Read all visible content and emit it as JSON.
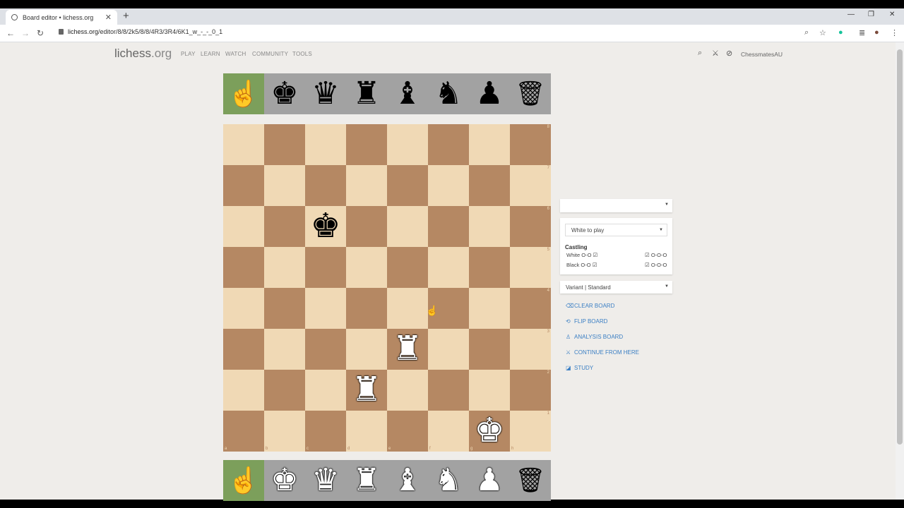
{
  "browser": {
    "tab_title": "Board editor • lichess.org",
    "tab_close": "✕",
    "new_tab": "+",
    "url_host": "lichess.org",
    "url_path": "/editor/8/8/2k5/8/8/4R3/3R4/6K1_w_-_-_0_1"
  },
  "site": {
    "logo_main": "lichess",
    "logo_tld": ".org",
    "menu": [
      "PLAY",
      "LEARN",
      "WATCH",
      "COMMUNITY",
      "TOOLS"
    ],
    "username": "ChessmatesAU"
  },
  "spare_top": [
    {
      "piece": "hand",
      "glyph": "☝",
      "selected": true
    },
    {
      "piece": "black-king",
      "glyph": "♚"
    },
    {
      "piece": "black-queen",
      "glyph": "♛"
    },
    {
      "piece": "black-rook",
      "glyph": "♜"
    },
    {
      "piece": "black-bishop",
      "glyph": "♝"
    },
    {
      "piece": "black-knight",
      "glyph": "♞"
    },
    {
      "piece": "black-pawn",
      "glyph": "♟"
    },
    {
      "piece": "trash",
      "glyph": "🗑"
    }
  ],
  "spare_bottom": [
    {
      "piece": "hand",
      "glyph": "☝",
      "selected": true
    },
    {
      "piece": "white-king",
      "glyph": "♚"
    },
    {
      "piece": "white-queen",
      "glyph": "♛"
    },
    {
      "piece": "white-rook",
      "glyph": "♜"
    },
    {
      "piece": "white-bishop",
      "glyph": "♝"
    },
    {
      "piece": "white-knight",
      "glyph": "♞"
    },
    {
      "piece": "white-pawn",
      "glyph": "♟"
    },
    {
      "piece": "trash",
      "glyph": "🗑"
    }
  ],
  "board": {
    "files": [
      "a",
      "b",
      "c",
      "d",
      "e",
      "f",
      "g",
      "h"
    ],
    "ranks": [
      "8",
      "7",
      "6",
      "5",
      "4",
      "3",
      "2",
      "1"
    ],
    "colors": {
      "light": "#f0d9b5",
      "dark": "#b58863"
    },
    "pieces": [
      {
        "square": "c6",
        "color": "black",
        "type": "king",
        "glyph": "♚"
      },
      {
        "square": "e3",
        "color": "white",
        "type": "rook",
        "glyph": "♜"
      },
      {
        "square": "d2",
        "color": "white",
        "type": "rook",
        "glyph": "♜"
      },
      {
        "square": "g1",
        "color": "white",
        "type": "king",
        "glyph": "♚"
      }
    ]
  },
  "controls": {
    "position_select": "",
    "turn_select": "White to play",
    "castling_title": "Castling",
    "white_castling": "White O-O",
    "black_castling": "Black O-O",
    "white_long": "O-O-O",
    "black_long": "O-O-O",
    "variant_select": "Variant | Standard",
    "actions": [
      {
        "label": "CLEAR BOARD",
        "icon": "trash-icon",
        "glyph": "⌫"
      },
      {
        "label": "FLIP BOARD",
        "icon": "flip-icon",
        "glyph": "⟲"
      },
      {
        "label": "ANALYSIS BOARD",
        "icon": "analysis-icon",
        "glyph": "♙"
      },
      {
        "label": "CONTINUE FROM HERE",
        "icon": "swords-icon",
        "glyph": "⚔"
      },
      {
        "label": "STUDY",
        "icon": "study-icon",
        "glyph": "◪"
      }
    ]
  },
  "accent": "#7c9f5b",
  "link_color": "#3b7fc4"
}
